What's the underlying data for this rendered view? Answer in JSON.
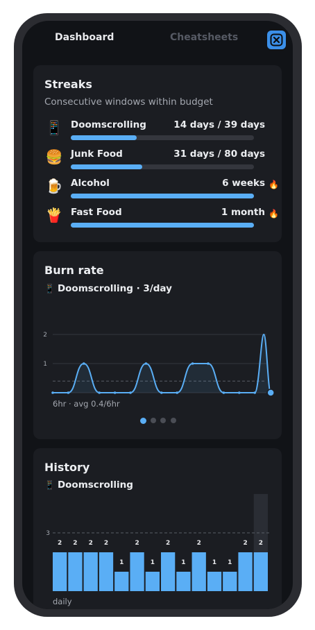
{
  "tabs": {
    "dashboard": "Dashboard",
    "cheatsheets": "Cheatsheets"
  },
  "close_icon": "close-x-icon",
  "colors": {
    "accent": "#5aaef5",
    "card": "#1b1d22",
    "background": "#111317"
  },
  "streaks": {
    "title": "Streaks",
    "subtitle": "Consecutive windows within budget",
    "items": [
      {
        "emoji": "📱",
        "icon": "phone-icon",
        "name": "Doomscrolling",
        "value": "14 days / 39 days",
        "progress": 0.36,
        "flame": ""
      },
      {
        "emoji": "🍔",
        "icon": "burger-icon",
        "name": "Junk Food",
        "value": "31 days / 80 days",
        "progress": 0.39,
        "flame": ""
      },
      {
        "emoji": "🍺",
        "icon": "beer-icon",
        "name": "Alcohol",
        "value": "6 weeks",
        "progress": 1.0,
        "flame": "🔥"
      },
      {
        "emoji": "🍟",
        "icon": "fries-icon",
        "name": "Fast Food",
        "value": "1 month",
        "progress": 1.0,
        "flame": "🔥"
      }
    ]
  },
  "burn_rate": {
    "title": "Burn rate",
    "emoji": "📱",
    "subtitle": "Doomscrolling · 3/day",
    "footer": "6hr · avg 0.4/6hr",
    "pager": {
      "count": 4,
      "active": 0
    }
  },
  "history": {
    "title": "History",
    "emoji": "📱",
    "subtitle": "Doomscrolling",
    "footer": "daily"
  },
  "chart_data": [
    {
      "type": "line",
      "title": "Burn rate",
      "y_ticks": [
        "1",
        "2"
      ],
      "ylim": [
        0,
        2.2
      ],
      "avg_line": 0.4,
      "x": [
        0,
        1,
        2,
        3,
        4,
        5,
        6,
        7,
        8,
        9,
        10,
        11,
        12,
        13
      ],
      "values": [
        0,
        0,
        1,
        0,
        0,
        0,
        1,
        0,
        0,
        1,
        1,
        0,
        0,
        0
      ],
      "tail_peak": 2,
      "tail_end": 0,
      "grid": true
    },
    {
      "type": "bar",
      "title": "History",
      "ylim": [
        0,
        3.6
      ],
      "budget_line": 3,
      "budget_label": "3",
      "values": [
        2,
        2,
        2,
        2,
        1,
        2,
        1,
        2,
        1,
        2,
        1,
        1,
        2,
        2
      ],
      "labels": [
        "2",
        "2",
        "2",
        "2",
        "1",
        "2",
        "1",
        "2",
        "1",
        "2",
        "1",
        "1",
        "2",
        "2"
      ],
      "highlight_last": true
    }
  ]
}
